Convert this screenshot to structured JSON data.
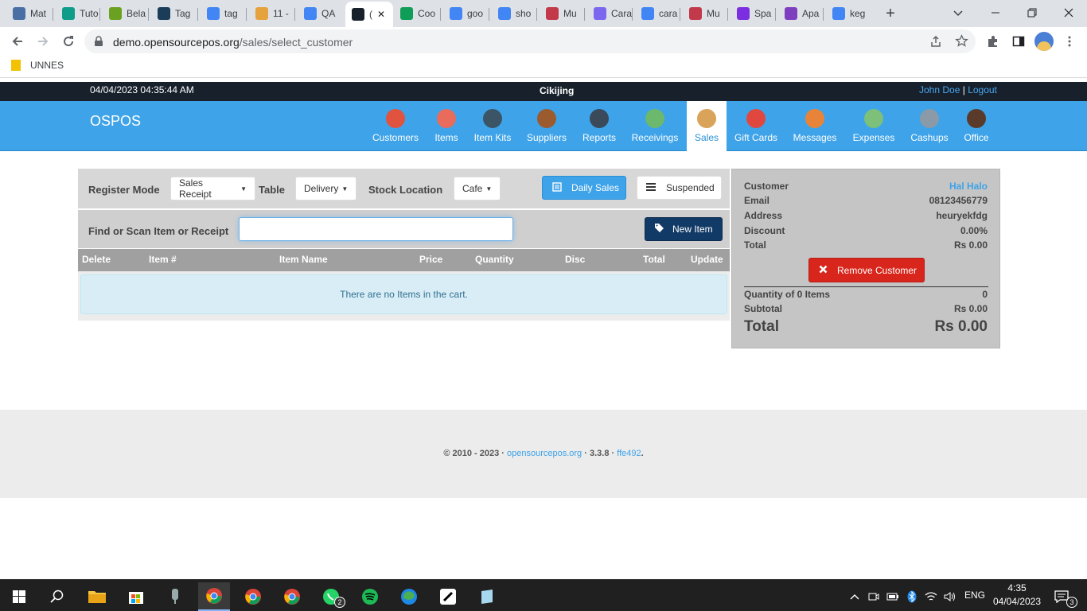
{
  "browser": {
    "tabs": [
      {
        "label": "Mat",
        "color": "#4a6fa5"
      },
      {
        "label": "Tuto",
        "color": "#0f9d8a"
      },
      {
        "label": "Bela",
        "color": "#6aa121"
      },
      {
        "label": "Tag",
        "color": "#1c3d5a"
      },
      {
        "label": "tag",
        "color": "#4285f4"
      },
      {
        "label": "11 -",
        "color": "#e6a23c"
      },
      {
        "label": "QA",
        "color": "#4285f4"
      },
      {
        "label": "(",
        "color": "#17202b"
      },
      {
        "label": "Coo",
        "color": "#0f9d58"
      },
      {
        "label": "goo",
        "color": "#4285f4"
      },
      {
        "label": "sho",
        "color": "#4285f4"
      },
      {
        "label": "Mu",
        "color": "#c23a4a"
      },
      {
        "label": "Cara",
        "color": "#7b68ee"
      },
      {
        "label": "cara",
        "color": "#4285f4"
      },
      {
        "label": "Mu",
        "color": "#c23a4a"
      },
      {
        "label": "Spa",
        "color": "#7b2fe0"
      },
      {
        "label": "Apa",
        "color": "#7e3fbf"
      },
      {
        "label": "keg",
        "color": "#4285f4"
      }
    ],
    "url_host": "demo.opensourcepos.org",
    "url_path": "/sales/select_customer",
    "bookmark": "UNNES"
  },
  "app": {
    "datetime": "04/04/2023 04:35:44 AM",
    "store": "Cikijing",
    "user": "John Doe",
    "sep": "|",
    "logout": "Logout",
    "brand": "OSPOS",
    "nav": [
      {
        "label": "Customers",
        "color": "#e0533f",
        "icon": "customers-icon"
      },
      {
        "label": "Items",
        "color": "#e86b5c",
        "icon": "items-icon"
      },
      {
        "label": "Item Kits",
        "color": "#3b5566",
        "icon": "item-kits-icon"
      },
      {
        "label": "Suppliers",
        "color": "#9c5a2f",
        "icon": "suppliers-icon"
      },
      {
        "label": "Reports",
        "color": "#3a4a5a",
        "icon": "reports-icon"
      },
      {
        "label": "Receivings",
        "color": "#6cb86c",
        "icon": "receivings-icon"
      },
      {
        "label": "Sales",
        "color": "#d9a35a",
        "icon": "sales-icon",
        "active": true
      },
      {
        "label": "Gift Cards",
        "color": "#e0483f",
        "icon": "gift-cards-icon"
      },
      {
        "label": "Messages",
        "color": "#e8843a",
        "icon": "messages-icon"
      },
      {
        "label": "Expenses",
        "color": "#7cc07a",
        "icon": "expenses-icon"
      },
      {
        "label": "Cashups",
        "color": "#8a9aa8",
        "icon": "cashups-icon"
      },
      {
        "label": "Office",
        "color": "#5a3a2a",
        "icon": "office-icon"
      }
    ]
  },
  "register": {
    "mode_label": "Register Mode",
    "mode_value": "Sales Receipt",
    "table_label": "Table",
    "table_value": "Delivery",
    "location_label": "Stock Location",
    "location_value": "Cafe",
    "daily_sales": "Daily Sales",
    "suspended": "Suspended",
    "find_label": "Find or Scan Item or Receipt",
    "find_placeholder": "",
    "new_item": "New Item",
    "columns": [
      "Delete",
      "Item #",
      "Item Name",
      "Price",
      "Quantity",
      "Disc",
      "Total",
      "Update"
    ],
    "empty_message": "There are no Items in the cart."
  },
  "customer": {
    "customer_label": "Customer",
    "customer_value": "Hal Halo",
    "email_label": "Email",
    "email_value": "08123456779",
    "address_label": "Address",
    "address_value": "heuryekfdg",
    "discount_label": "Discount",
    "discount_value": "0.00%",
    "total_label": "Total",
    "total_value": "Rs 0.00",
    "remove_button": "Remove Customer",
    "qty_label": "Quantity of 0 Items",
    "qty_value": "0",
    "subtotal_label": "Subtotal",
    "subtotal_value": "Rs 0.00",
    "grand_total_label": "Total",
    "grand_total_value": "Rs 0.00"
  },
  "footer": {
    "copyright": "© 2010 - 2023 ·",
    "link": "opensourcepos.org",
    "version": "· 3.3.8 ·",
    "commit": "ffe492",
    "dot": "."
  },
  "taskbar": {
    "lang": "ENG",
    "time": "4:35",
    "date": "04/04/2023",
    "whatsapp_badge": "2",
    "notif_badge": "3"
  }
}
